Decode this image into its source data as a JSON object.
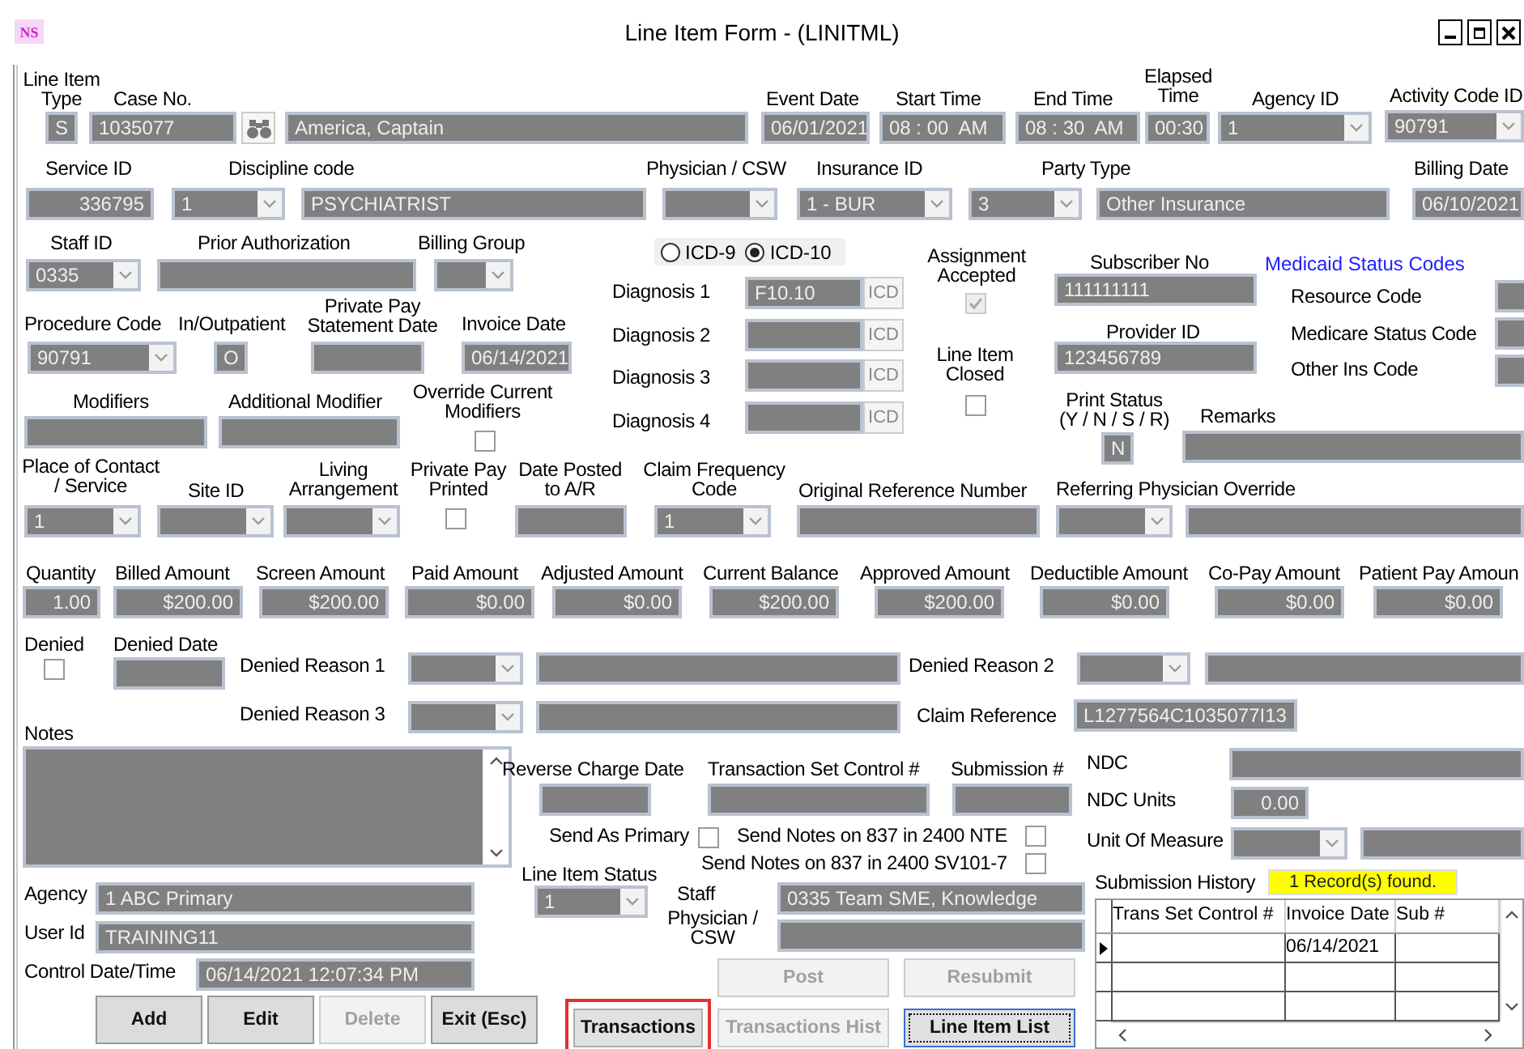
{
  "window": {
    "icon_text": "NS",
    "title": "Line Item Form - (LINITML)"
  },
  "form": [
    {
      "kind": "label",
      "text": "Line Item\nType"
    },
    {
      "kind": "label",
      "text": "Case No."
    },
    {
      "kind": "text",
      "value": "S"
    },
    {
      "kind": "text",
      "value": "1035077"
    },
    {
      "kind": "find"
    },
    {
      "kind": "text",
      "value": "America, Captain"
    },
    {
      "kind": "label",
      "text": "Event Date"
    },
    {
      "kind": "text",
      "value": "06/01/2021"
    },
    {
      "kind": "label",
      "text": "Start Time"
    },
    {
      "kind": "text",
      "value": "08 : 00  AM"
    },
    {
      "kind": "label",
      "text": "End Time"
    },
    {
      "kind": "text",
      "value": "08 : 30  AM"
    },
    {
      "kind": "label",
      "text": "Elapsed\nTime"
    },
    {
      "kind": "text",
      "value": "00:30"
    },
    {
      "kind": "label",
      "text": "Agency ID"
    },
    {
      "kind": "combo",
      "value": "1"
    },
    {
      "kind": "label",
      "text": "Activity Code ID"
    },
    {
      "kind": "combo",
      "value": "90791"
    },
    {
      "kind": "label",
      "text": "Service ID"
    },
    {
      "kind": "text",
      "value": "336795"
    },
    {
      "kind": "label",
      "text": "Discipline code"
    },
    {
      "kind": "combo",
      "value": "1"
    },
    {
      "kind": "text",
      "value": "PSYCHIATRIST"
    },
    {
      "kind": "label",
      "text": "Physician / CSW"
    },
    {
      "kind": "combo"
    },
    {
      "kind": "label",
      "text": "Insurance ID"
    },
    {
      "kind": "combo",
      "value": "1 - BUR"
    },
    {
      "kind": "label",
      "text": "Party Type"
    },
    {
      "kind": "combo",
      "value": "3"
    },
    {
      "kind": "text",
      "value": "Other Insurance"
    },
    {
      "kind": "label",
      "text": "Billing Date"
    },
    {
      "kind": "text",
      "value": "06/10/2021"
    },
    {
      "kind": "label",
      "text": "Staff ID"
    },
    {
      "kind": "combo",
      "value": "0335"
    },
    {
      "kind": "label",
      "text": "Prior Authorization"
    },
    {
      "kind": "text"
    },
    {
      "kind": "label",
      "text": "Billing Group"
    },
    {
      "kind": "combo"
    },
    {
      "kind": "radios",
      "options": [
        {
          "label": "ICD-9",
          "selected": false
        },
        {
          "label": "ICD-10",
          "selected": true
        }
      ]
    },
    {
      "kind": "label",
      "text": "Assignment\nAccepted"
    },
    {
      "kind": "check",
      "checked": true,
      "disabled": true
    },
    {
      "kind": "label",
      "text": "Subscriber No"
    },
    {
      "kind": "text",
      "value": "111111111"
    },
    {
      "kind": "link",
      "text": "Medicaid Status Codes"
    },
    {
      "kind": "label",
      "text": "Diagnosis 1"
    },
    {
      "kind": "text",
      "value": "F10.10"
    },
    {
      "kind": "icd",
      "label": "ICD"
    },
    {
      "kind": "label",
      "text": "Resource Code"
    },
    {
      "kind": "text"
    },
    {
      "kind": "label",
      "text": "Procedure Code"
    },
    {
      "kind": "combo",
      "value": "90791"
    },
    {
      "kind": "label",
      "text": "In/Outpatient"
    },
    {
      "kind": "text",
      "value": "O"
    },
    {
      "kind": "label",
      "text": "Private Pay\nStatement Date"
    },
    {
      "kind": "text"
    },
    {
      "kind": "label",
      "text": "Invoice Date"
    },
    {
      "kind": "text",
      "value": "06/14/2021"
    },
    {
      "kind": "label",
      "text": "Diagnosis 2"
    },
    {
      "kind": "text"
    },
    {
      "kind": "icd",
      "label": "ICD"
    },
    {
      "kind": "label",
      "text": "Provider ID"
    },
    {
      "kind": "text",
      "value": "123456789"
    },
    {
      "kind": "label",
      "text": "Medicare Status Code"
    },
    {
      "kind": "text"
    },
    {
      "kind": "label",
      "text": "Diagnosis 3"
    },
    {
      "kind": "text"
    },
    {
      "kind": "icd",
      "label": "ICD"
    },
    {
      "kind": "label",
      "text": "Line Item\nClosed"
    },
    {
      "kind": "check",
      "checked": false,
      "disabled": false
    },
    {
      "kind": "label",
      "text": "Other Ins Code"
    },
    {
      "kind": "text"
    },
    {
      "kind": "label",
      "text": "Modifiers"
    },
    {
      "kind": "text"
    },
    {
      "kind": "label",
      "text": "Additional Modifier"
    },
    {
      "kind": "text"
    },
    {
      "kind": "label",
      "text": "Override Current\nModifiers"
    },
    {
      "kind": "check",
      "checked": false,
      "disabled": false
    },
    {
      "kind": "label",
      "text": "Diagnosis 4"
    },
    {
      "kind": "text"
    },
    {
      "kind": "icd",
      "label": "ICD"
    },
    {
      "kind": "label",
      "text": "Print Status\n(Y / N / S / R)"
    },
    {
      "kind": "text",
      "value": "N"
    },
    {
      "kind": "label",
      "text": "Remarks"
    },
    {
      "kind": "text"
    },
    {
      "kind": "label",
      "text": "Place of Contact\n/ Service"
    },
    {
      "kind": "combo",
      "value": "1"
    },
    {
      "kind": "label",
      "text": "Site ID"
    },
    {
      "kind": "combo"
    },
    {
      "kind": "label",
      "text": "Living\nArrangement"
    },
    {
      "kind": "combo"
    },
    {
      "kind": "label",
      "text": "Private Pay\nPrinted"
    },
    {
      "kind": "check",
      "checked": false,
      "disabled": false
    },
    {
      "kind": "label",
      "text": "Date Posted\nto A/R"
    },
    {
      "kind": "text"
    },
    {
      "kind": "label",
      "text": "Claim Frequency\nCode"
    },
    {
      "kind": "combo",
      "value": "1"
    },
    {
      "kind": "label",
      "text": "Original Reference Number"
    },
    {
      "kind": "text"
    },
    {
      "kind": "label",
      "text": "Referring Physician Override"
    },
    {
      "kind": "combo"
    },
    {
      "kind": "text"
    },
    {
      "kind": "label",
      "text": "Quantity"
    },
    {
      "kind": "text",
      "value": "1.00"
    },
    {
      "kind": "label",
      "text": "Billed Amount"
    },
    {
      "kind": "text",
      "value": "$200.00"
    },
    {
      "kind": "label",
      "text": "Screen Amount"
    },
    {
      "kind": "text",
      "value": "$200.00"
    },
    {
      "kind": "label",
      "text": "Paid Amount"
    },
    {
      "kind": "text",
      "value": "$0.00"
    },
    {
      "kind": "label",
      "text": "Adjusted Amount"
    },
    {
      "kind": "text",
      "value": "$0.00"
    },
    {
      "kind": "label",
      "text": "Current Balance"
    },
    {
      "kind": "text",
      "value": "$200.00"
    },
    {
      "kind": "label",
      "text": "Approved Amount"
    },
    {
      "kind": "text",
      "value": "$200.00"
    },
    {
      "kind": "label",
      "text": "Deductible Amount"
    },
    {
      "kind": "text",
      "value": "$0.00"
    },
    {
      "kind": "label",
      "text": "Co-Pay Amount"
    },
    {
      "kind": "text",
      "value": "$0.00"
    },
    {
      "kind": "label",
      "text": "Patient Pay Amoun"
    },
    {
      "kind": "text",
      "value": "$0.00"
    },
    {
      "kind": "label",
      "text": "Denied"
    },
    {
      "kind": "check",
      "checked": false,
      "disabled": false
    },
    {
      "kind": "label",
      "text": "Denied Date"
    },
    {
      "kind": "text"
    },
    {
      "kind": "label",
      "text": "Denied Reason 1"
    },
    {
      "kind": "combo"
    },
    {
      "kind": "text"
    },
    {
      "kind": "label",
      "text": "Denied Reason 2"
    },
    {
      "kind": "combo"
    },
    {
      "kind": "text"
    },
    {
      "kind": "label",
      "text": "Denied Reason 3"
    },
    {
      "kind": "combo"
    },
    {
      "kind": "text"
    },
    {
      "kind": "label",
      "text": "Claim Reference"
    },
    {
      "kind": "text",
      "value": "L1277564C1035077I13"
    },
    {
      "kind": "label",
      "text": "Notes"
    },
    {
      "kind": "notes"
    },
    {
      "kind": "label",
      "text": "Reverse Charge Date"
    },
    {
      "kind": "text"
    },
    {
      "kind": "label",
      "text": "Transaction Set Control #"
    },
    {
      "kind": "text"
    },
    {
      "kind": "label",
      "text": "Submission #"
    },
    {
      "kind": "text"
    },
    {
      "kind": "label",
      "text": "NDC"
    },
    {
      "kind": "text"
    },
    {
      "kind": "label",
      "text": "NDC Units"
    },
    {
      "kind": "text",
      "value": "0.00"
    },
    {
      "kind": "label",
      "text": "Send As Primary"
    },
    {
      "kind": "check",
      "checked": false,
      "disabled": false
    },
    {
      "kind": "label",
      "text": "Send Notes on 837 in 2400 NTE"
    },
    {
      "kind": "check",
      "checked": false,
      "disabled": false
    },
    {
      "kind": "label",
      "text": "Unit Of Measure"
    },
    {
      "kind": "combo"
    },
    {
      "kind": "text"
    },
    {
      "kind": "label",
      "text": "Send Notes on 837 in 2400 SV101-7"
    },
    {
      "kind": "check",
      "checked": false,
      "disabled": false
    },
    {
      "kind": "label",
      "text": "Agency"
    },
    {
      "kind": "text",
      "value": "1 ABC Primary"
    },
    {
      "kind": "label",
      "text": "Line Item Status"
    },
    {
      "kind": "combo",
      "value": "1"
    },
    {
      "kind": "label",
      "text": "Staff"
    },
    {
      "kind": "text",
      "value": "0335 Team SME, Knowledge"
    },
    {
      "kind": "label",
      "text": "Submission History"
    },
    {
      "kind": "badge",
      "text": "1 Record(s) found."
    },
    {
      "kind": "label",
      "text": "User Id"
    },
    {
      "kind": "text",
      "value": "TRAINING11"
    },
    {
      "kind": "label",
      "text": "Physician /\nCSW"
    },
    {
      "kind": "text"
    },
    {
      "kind": "label",
      "text": "Control Date/Time"
    },
    {
      "kind": "text",
      "value": "06/14/2021 12:07:34 PM"
    },
    {
      "kind": "button",
      "label": "Post",
      "disabled": true,
      "highlighted": false,
      "focused": false
    },
    {
      "kind": "button",
      "label": "Resubmit",
      "disabled": true,
      "highlighted": false,
      "focused": false
    },
    {
      "kind": "button",
      "label": "Add",
      "disabled": false,
      "highlighted": false,
      "focused": false
    },
    {
      "kind": "button",
      "label": "Edit",
      "disabled": false,
      "highlighted": false,
      "focused": false
    },
    {
      "kind": "button",
      "label": "Delete",
      "disabled": true,
      "highlighted": false,
      "focused": false
    },
    {
      "kind": "button",
      "label": "Exit (Esc)",
      "disabled": false,
      "highlighted": false,
      "focused": false
    },
    {
      "kind": "button",
      "label": "Transactions",
      "disabled": false,
      "highlighted": true,
      "focused": false
    },
    {
      "kind": "button",
      "label": "Transactions Hist",
      "disabled": true,
      "highlighted": false,
      "focused": false
    },
    {
      "kind": "button",
      "label": "Line Item List",
      "disabled": false,
      "highlighted": false,
      "focused": true
    }
  ],
  "submission_history": {
    "columns": [
      "Trans Set Control #",
      "Invoice Date",
      "Sub #"
    ],
    "rows": [
      {
        "invoice_date": "06/14/2021",
        "current": true
      }
    ]
  }
}
